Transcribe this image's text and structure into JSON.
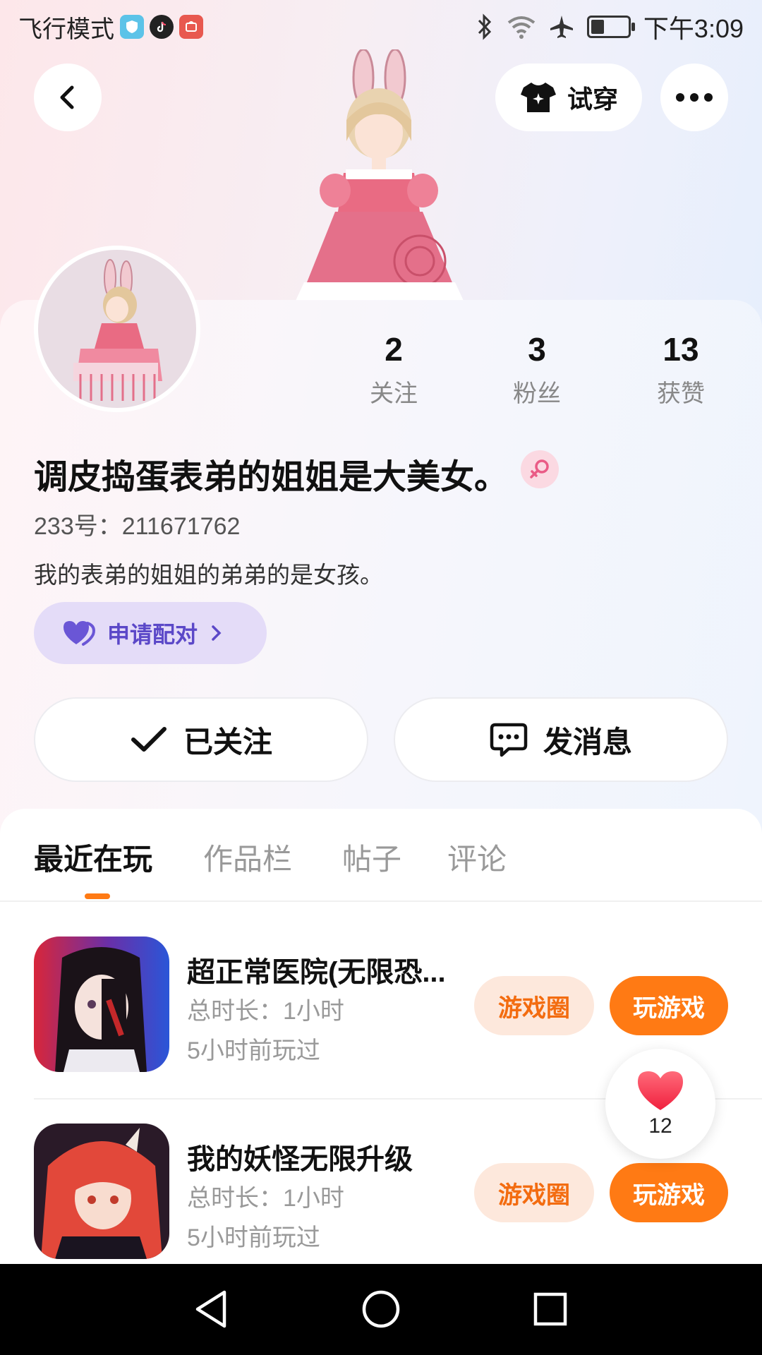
{
  "status_bar": {
    "left_text": "飞行模式",
    "time": "下午3:09",
    "battery_level": 0.35
  },
  "header": {
    "back_icon": "chevron-left-icon",
    "try_on_label": "试穿",
    "more_icon": "more-dots-icon"
  },
  "profile": {
    "stats": [
      {
        "value": "2",
        "label": "关注"
      },
      {
        "value": "3",
        "label": "粉丝"
      },
      {
        "value": "13",
        "label": "获赞"
      }
    ],
    "username": "调皮捣蛋表弟的姐姐是大美女。",
    "gender_icon": "female-icon",
    "uid": "233号：211671762",
    "bio": "我的表弟的姐姐的弟弟的是女孩。",
    "pair_label": "申请配对"
  },
  "actions": {
    "follow_label": "已关注",
    "message_label": "发消息"
  },
  "tabs": [
    {
      "label": "最近在玩",
      "active": true
    },
    {
      "label": "作品栏",
      "active": false
    },
    {
      "label": "帖子",
      "active": false
    },
    {
      "label": "评论",
      "active": false
    }
  ],
  "games": [
    {
      "title": "超正常医院(无限恐...",
      "duration": "总时长：1小时",
      "last_played": "5小时前玩过",
      "circle_label": "游戏圈",
      "play_label": "玩游戏"
    },
    {
      "title": "我的妖怪无限升级",
      "duration": "总时长：1小时",
      "last_played": "5小时前玩过",
      "circle_label": "游戏圈",
      "play_label": "玩游戏"
    }
  ],
  "like_float": {
    "count": "12"
  },
  "colors": {
    "accent": "#ff7a14",
    "pair_bg": "#e4dcf8",
    "pair_text": "#5b48c8",
    "circle_btn_bg": "#fde8dc"
  }
}
